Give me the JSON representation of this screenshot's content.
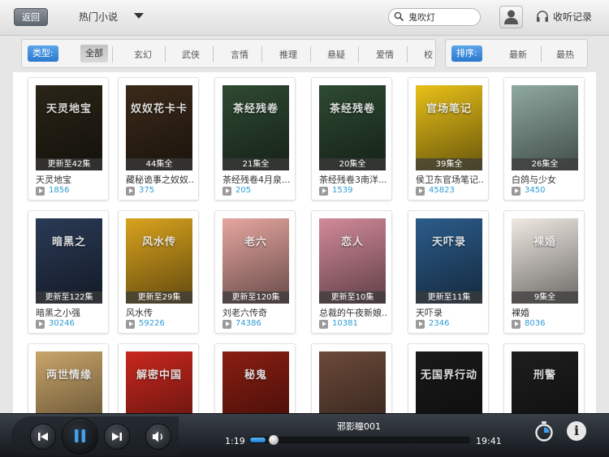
{
  "header": {
    "back_label": "返回",
    "title": "热门小说",
    "search_value": "鬼吹灯",
    "listen_history_label": "收听记录"
  },
  "filter_type": {
    "key_label": "类型:",
    "options": [
      "全部",
      "玄幻",
      "武侠",
      "言情",
      "推理",
      "悬疑",
      "爱情",
      "校"
    ],
    "selected": "全部"
  },
  "filter_sort": {
    "key_label": "排序:",
    "options": [
      "最新",
      "最热"
    ]
  },
  "books": [
    {
      "title": "天灵地宝",
      "badge": "更新至42集",
      "plays": "1856",
      "cover_text": "天灵地宝",
      "cover_color": "#2a2518"
    },
    {
      "title": "藏秘诡事之奴奴...",
      "badge": "44集全",
      "plays": "375",
      "cover_text": "奴奴花卡卡",
      "cover_color": "#3b2a1a"
    },
    {
      "title": "茶经残卷4月泉...",
      "badge": "21集全",
      "plays": "205",
      "cover_text": "茶经残卷",
      "cover_color": "#2f4a33"
    },
    {
      "title": "茶经残卷3南洋...",
      "badge": "20集全",
      "plays": "1539",
      "cover_text": "茶经残卷",
      "cover_color": "#2e4a33"
    },
    {
      "title": "侯卫东官场笔记...",
      "badge": "39集全",
      "plays": "45823",
      "cover_text": "官场笔记",
      "cover_color": "#e8c018"
    },
    {
      "title": "白鸽与少女",
      "badge": "26集全",
      "plays": "3450",
      "cover_text": "",
      "cover_color": "#8fa9a0"
    },
    {
      "title": "暗黑之小强",
      "badge": "更新至122集",
      "plays": "30246",
      "cover_text": "暗黑之",
      "cover_color": "#2a3a55"
    },
    {
      "title": "风水传",
      "badge": "更新至29集",
      "plays": "59226",
      "cover_text": "风水传",
      "cover_color": "#d9a31e"
    },
    {
      "title": "刘老六传奇",
      "badge": "更新至120集",
      "plays": "74386",
      "cover_text": "老六",
      "cover_color": "#e6a6a0"
    },
    {
      "title": "总裁的午夜新娘...",
      "badge": "更新至10集",
      "plays": "10381",
      "cover_text": "恋人",
      "cover_color": "#d28a9a"
    },
    {
      "title": "天吓录",
      "badge": "更新至11集",
      "plays": "2346",
      "cover_text": "天吓录",
      "cover_color": "#2c5c8a"
    },
    {
      "title": "裸婚",
      "badge": "9集全",
      "plays": "8036",
      "cover_text": "裸婚",
      "cover_color": "#efe9e2"
    },
    {
      "title": "",
      "badge": "",
      "plays": "",
      "cover_text": "两世情缘",
      "cover_color": "#c9a56a"
    },
    {
      "title": "",
      "badge": "",
      "plays": "",
      "cover_text": "解密中国",
      "cover_color": "#c9281e"
    },
    {
      "title": "",
      "badge": "",
      "plays": "",
      "cover_text": "秘鬼",
      "cover_color": "#8a1e12"
    },
    {
      "title": "",
      "badge": "",
      "plays": "",
      "cover_text": "",
      "cover_color": "#6b4a3a"
    },
    {
      "title": "",
      "badge": "",
      "plays": "",
      "cover_text": "无国界行动",
      "cover_color": "#1a1a1a"
    },
    {
      "title": "",
      "badge": "",
      "plays": "",
      "cover_text": "刑警",
      "cover_color": "#1e1e1e"
    }
  ],
  "player": {
    "track_title": "邪影瞳001",
    "elapsed": "1:19",
    "total": "19:41",
    "progress": 0.07
  },
  "icons": {
    "back": "back-arrow-icon",
    "dropdown": "chevron-down-icon",
    "search": "search-icon",
    "user": "user-icon",
    "headphones": "headphones-icon",
    "prev": "previous-icon",
    "pause": "pause-icon",
    "next": "next-icon",
    "volume": "volume-icon",
    "timer": "timer-icon",
    "info": "info-icon"
  },
  "colors": {
    "accent_blue": "#2b77cf",
    "play_count_blue": "#2f9bd6"
  }
}
